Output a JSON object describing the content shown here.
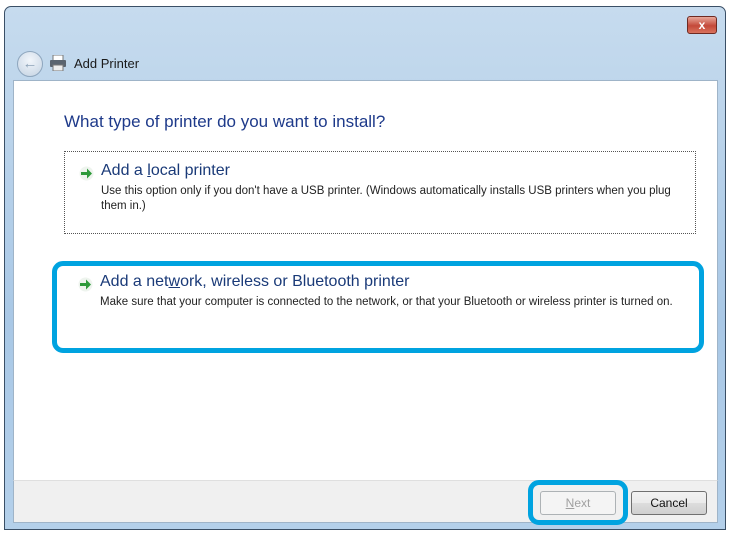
{
  "window": {
    "title": "Add Printer",
    "close_label": "x"
  },
  "heading": "What type of printer do you want to install?",
  "options": [
    {
      "title_pre": "Add a ",
      "title_key": "l",
      "title_post": "ocal printer",
      "description": "Use this option only if you don't have a USB printer. (Windows automatically installs USB printers when you plug them in.)"
    },
    {
      "title_pre": "Add a net",
      "title_key": "w",
      "title_post": "ork, wireless or Bluetooth printer",
      "description": "Make sure that your computer is connected to the network, or that your Bluetooth or wireless printer is turned on."
    }
  ],
  "buttons": {
    "next_key": "N",
    "next_rest": "ext",
    "cancel": "Cancel"
  },
  "colors": {
    "highlight": "#00a3e0",
    "heading": "#1e3a8a"
  }
}
